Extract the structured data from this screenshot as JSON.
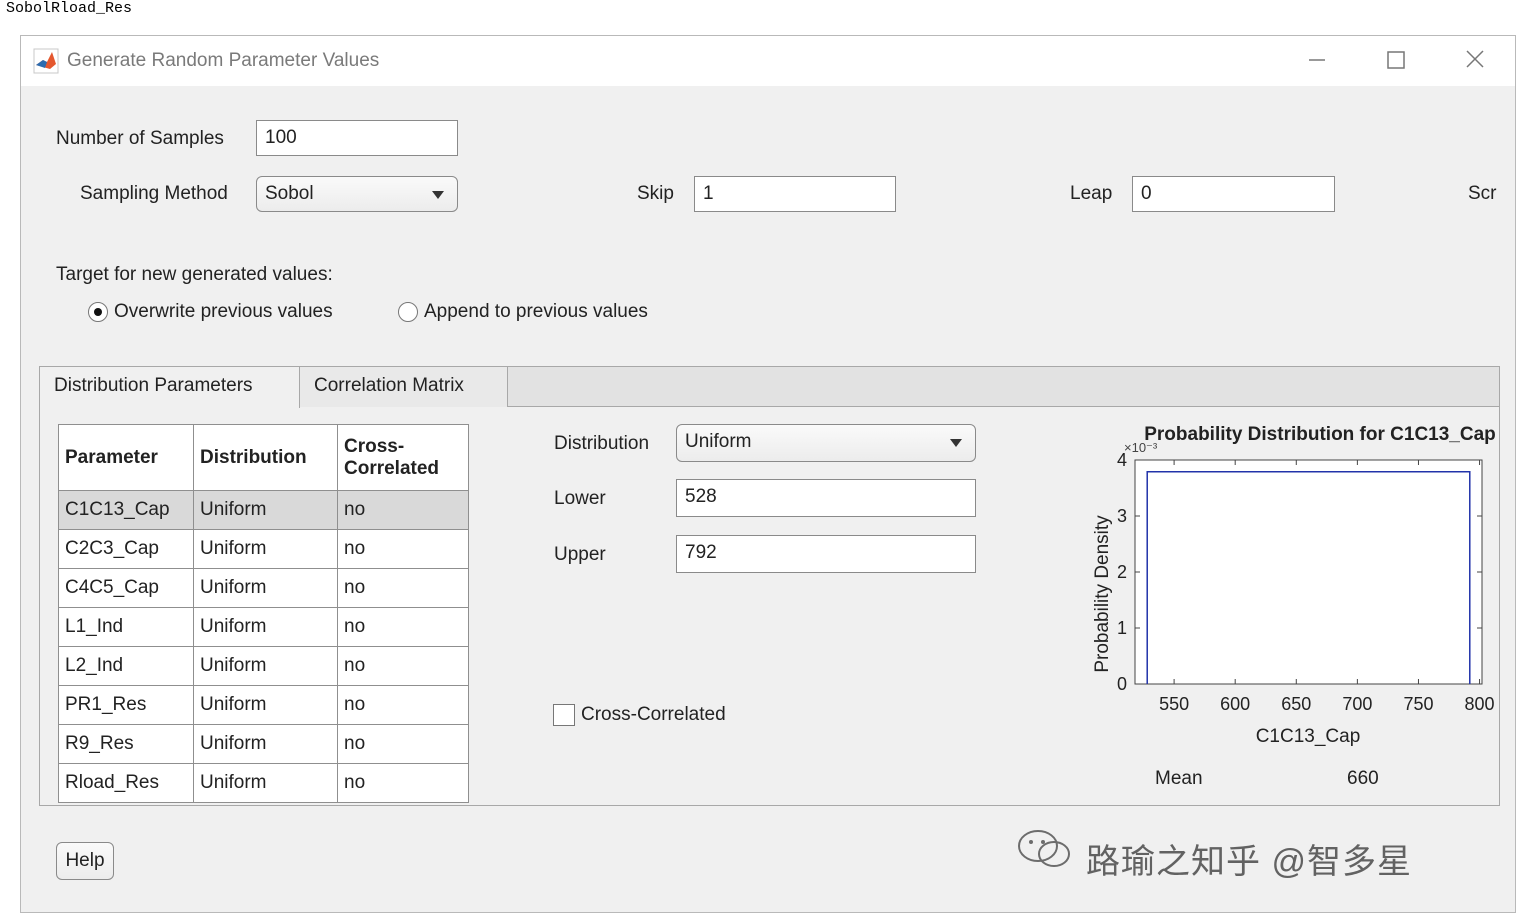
{
  "top_text": "SobolRload_Res",
  "window": {
    "title": "Generate Random Parameter Values",
    "icon": "matlab-logo-icon",
    "controls": [
      "minimize-icon",
      "maximize-icon",
      "close-icon"
    ]
  },
  "form": {
    "num_samples_label": "Number of Samples",
    "num_samples_value": "100",
    "sampling_method_label": "Sampling Method",
    "sampling_method_value": "Sobol",
    "skip_label": "Skip",
    "skip_value": "1",
    "leap_label": "Leap",
    "leap_value": "0",
    "scramble_label_partial": "Scr"
  },
  "target": {
    "label": "Target for new generated values:",
    "options": [
      {
        "label": "Overwrite previous values",
        "selected": true
      },
      {
        "label": "Append to previous values",
        "selected": false
      }
    ]
  },
  "tabs": [
    {
      "label": "Distribution Parameters",
      "active": true
    },
    {
      "label": "Correlation Matrix",
      "active": false
    }
  ],
  "table": {
    "headers": [
      "Parameter",
      "Distribution",
      "Cross-\nCorrelated"
    ],
    "header_lines": {
      "cross1": "Cross-",
      "cross2": "Correlated"
    },
    "rows": [
      {
        "parameter": "C1C13_Cap",
        "distribution": "Uniform",
        "cross": "no"
      },
      {
        "parameter": "C2C3_Cap",
        "distribution": "Uniform",
        "cross": "no"
      },
      {
        "parameter": "C4C5_Cap",
        "distribution": "Uniform",
        "cross": "no"
      },
      {
        "parameter": "L1_Ind",
        "distribution": "Uniform",
        "cross": "no"
      },
      {
        "parameter": "L2_Ind",
        "distribution": "Uniform",
        "cross": "no"
      },
      {
        "parameter": "PR1_Res",
        "distribution": "Uniform",
        "cross": "no"
      },
      {
        "parameter": "R9_Res",
        "distribution": "Uniform",
        "cross": "no"
      },
      {
        "parameter": "Rload_Res",
        "distribution": "Uniform",
        "cross": "no"
      }
    ],
    "selected_row": 0
  },
  "details": {
    "distribution_label": "Distribution",
    "distribution_value": "Uniform",
    "lower_label": "Lower",
    "lower_value": "528",
    "upper_label": "Upper",
    "upper_value": "792",
    "cross_correlated_label": "Cross-Correlated",
    "cross_correlated_checked": false
  },
  "chart_data": {
    "type": "line",
    "title": "Probability Distribution for C1C13_Cap",
    "xlabel": "C1C13_Cap",
    "ylabel": "Probability  Density",
    "y_exponent_label": "×10⁻³",
    "xlim": [
      518,
      802
    ],
    "ylim": [
      0,
      4
    ],
    "xticks": [
      550,
      600,
      650,
      700,
      750,
      800
    ],
    "yticks": [
      0,
      1,
      2,
      3,
      4
    ],
    "series": [
      {
        "x": [
          528,
          528,
          792,
          792
        ],
        "y": [
          0,
          3.79,
          3.79,
          0
        ],
        "color": "#2233aa"
      }
    ],
    "mean_label": "Mean",
    "mean_value": "660"
  },
  "footer": {
    "help_label": "Help",
    "watermark_text": "路瑜之知乎 @智多星"
  }
}
